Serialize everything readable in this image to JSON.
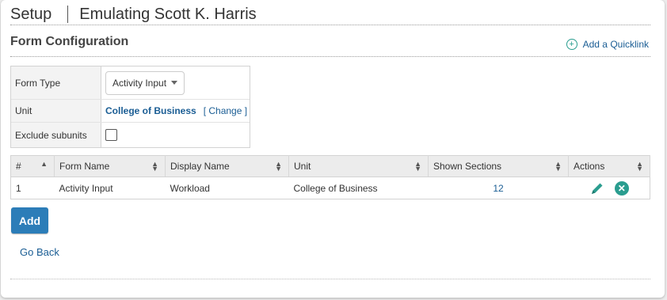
{
  "header": {
    "title": "Setup",
    "emulating": "Emulating Scott K. Harris"
  },
  "section": {
    "title": "Form Configuration",
    "quicklink_label": "Add a Quicklink"
  },
  "config": {
    "form_type_label": "Form Type",
    "form_type_value": "Activity Input",
    "unit_label": "Unit",
    "unit_value": "College of Business",
    "change_label": "[ Change ]",
    "exclude_label": "Exclude subunits",
    "exclude_checked": false
  },
  "table": {
    "columns": [
      "#",
      "Form Name",
      "Display Name",
      "Unit",
      "Shown Sections",
      "Actions"
    ],
    "rows": [
      {
        "num": "1",
        "form_name": "Activity Input",
        "display_name": "Workload",
        "unit": "College of Business",
        "shown_sections": "12"
      }
    ]
  },
  "buttons": {
    "add_label": "Add",
    "go_back_label": "Go Back"
  },
  "colors": {
    "accent": "#2a9d8f",
    "link": "#1a5d94",
    "primary_button": "#2c7db8"
  }
}
